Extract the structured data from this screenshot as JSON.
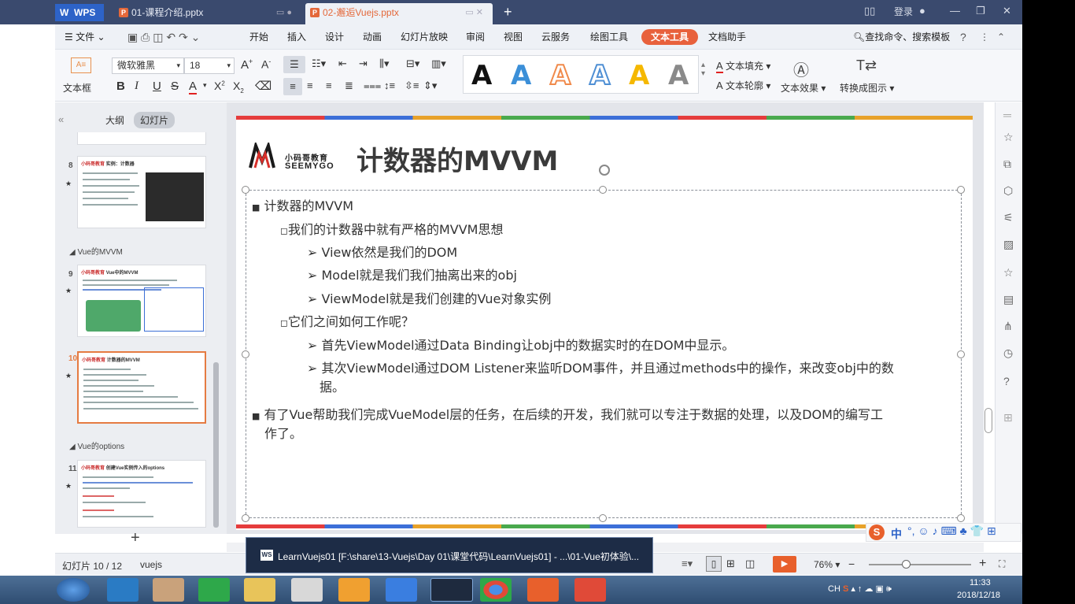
{
  "titlebar": {
    "app": "WPS",
    "tabs": [
      {
        "label": "01-课程介绍.pptx"
      },
      {
        "label": "02-邂逅Vuejs.pptx"
      }
    ],
    "login": "登录"
  },
  "menu": {
    "file": "文件",
    "items": [
      "开始",
      "插入",
      "设计",
      "动画",
      "幻灯片放映",
      "审阅",
      "视图",
      "云服务",
      "绘图工具"
    ],
    "active": "文本工具",
    "assistant": "文档助手",
    "search": "查找命令、搜索模板"
  },
  "ribbon": {
    "textbox": "文本框",
    "font": "微软雅黑",
    "size": "18",
    "fill": "文本填充",
    "outline": "文本轮廓",
    "effect": "文本效果",
    "convert": "转换成图示"
  },
  "left_pane": {
    "tab_outline": "大纲",
    "tab_slides": "幻灯片",
    "sections": [
      "Vue的MVVM",
      "Vue的options"
    ],
    "slides": [
      {
        "num": "8",
        "title": "实例：计数器"
      },
      {
        "num": "9",
        "title": "Vue中的MVVM"
      },
      {
        "num": "10",
        "title": "计数器的MVVM"
      },
      {
        "num": "11",
        "title": "创建Vue实例传入的options"
      }
    ],
    "logo_text": "小码哥教育"
  },
  "slide": {
    "logo_cn": "小码哥教育",
    "logo_en": "SEEMYGO",
    "title": "计数器的MVVM",
    "lines": [
      "计数器的MVVM",
      "我们的计数器中就有严格的MVVM思想",
      "View依然是我们的DOM",
      "Model就是我们我们抽离出来的obj",
      "ViewModel就是我们创建的Vue对象实例",
      "它们之间如何工作呢？",
      "首先ViewModel通过Data Binding让obj中的数据实时的在DOM中显示。",
      "其次ViewModel通过DOM Listener来监听DOM事件，并且通过methods中的操作，来改变obj中的数",
      "据。",
      "有了Vue帮助我们完成VueModel层的任务，在后续的开发，我们就可以专注于数据的处理，以及DOM的编写工",
      "作了。"
    ]
  },
  "statusbar": {
    "slide_info": "幻灯片 10 / 12",
    "theme": "vuejs",
    "zoom": "76%"
  },
  "popup": {
    "text": "LearnVuejs01 [F:\\share\\13-Vuejs\\Day 01\\课堂代码\\LearnVuejs01] - ...\\01-Vue初体验\\..."
  },
  "tray": {
    "time": "11:33",
    "date": "2018/12/18",
    "ime": "中"
  }
}
